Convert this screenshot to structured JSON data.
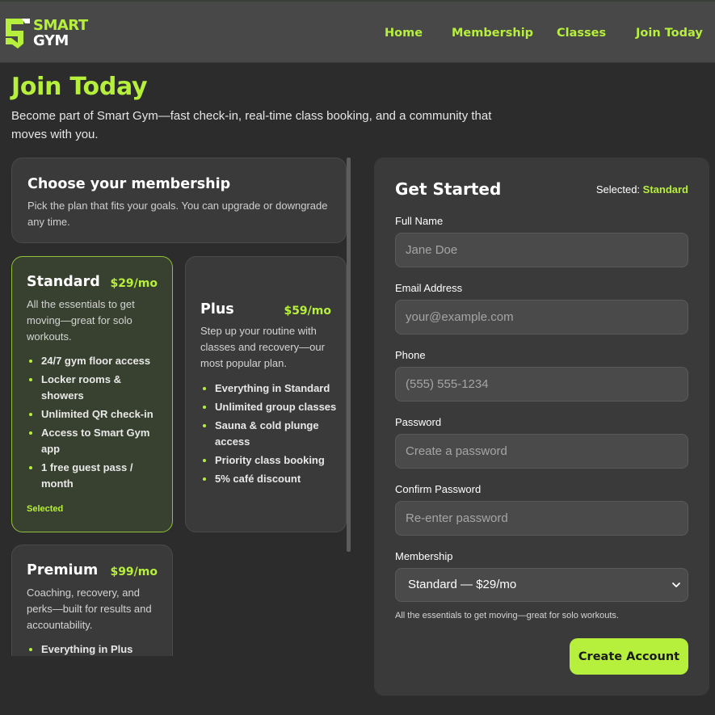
{
  "brand": {
    "line1": "SMART",
    "line2": "GYM",
    "accent_color": "#b6f03c"
  },
  "nav": {
    "items": [
      {
        "label": "Home"
      },
      {
        "label": "Membership"
      },
      {
        "label": "Classes"
      },
      {
        "label": "Join Today"
      }
    ]
  },
  "hero": {
    "title": "Join Today",
    "subtitle": "Become part of Smart Gym—fast check-in, real-time class booking, and a community that moves with you."
  },
  "membership_intro": {
    "title": "Choose your membership",
    "description": "Pick the plan that fits your goals. You can upgrade or downgrade any time."
  },
  "plans": [
    {
      "name": "Standard",
      "price": "$29/mo",
      "description": "All the essentials to get moving—great for solo workouts.",
      "features": [
        "24/7 gym floor access",
        "Locker rooms & showers",
        "Unlimited QR check-in",
        "Access to Smart Gym app",
        "1 free guest pass / month"
      ],
      "selected_label": "Selected"
    },
    {
      "name": "Plus",
      "price": "$59/mo",
      "description": "Step up your routine with classes and recovery—our most popular plan.",
      "features": [
        "Everything in Standard",
        "Unlimited group classes",
        "Sauna & cold plunge access",
        "Priority class booking",
        "5% café discount"
      ]
    },
    {
      "name": "Premium",
      "price": "$99/mo",
      "description": "Coaching, recovery, and perks—built for results and accountability.",
      "features": [
        "Everything in Plus"
      ]
    }
  ],
  "form": {
    "title": "Get Started",
    "selected_prefix": "Selected:",
    "selected_value": "Standard",
    "fields": {
      "full_name": {
        "label": "Full Name",
        "placeholder": "Jane Doe"
      },
      "email": {
        "label": "Email Address",
        "placeholder": "your@example.com"
      },
      "phone": {
        "label": "Phone",
        "placeholder": "(555) 555-1234"
      },
      "password": {
        "label": "Password",
        "placeholder": "Create a password"
      },
      "confirm_password": {
        "label": "Confirm Password",
        "placeholder": "Re-enter password"
      }
    },
    "membership": {
      "label": "Membership",
      "value": "Standard — $29/mo",
      "help": "All the essentials to get moving—great for solo workouts."
    },
    "submit_label": "Create Account"
  }
}
